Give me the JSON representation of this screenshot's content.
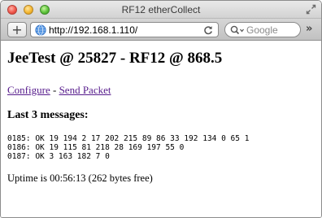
{
  "window": {
    "title": "RF12 etherCollect"
  },
  "toolbar": {
    "new_tab_label": "+",
    "url": "http://192.168.1.110/",
    "search_placeholder": "Google",
    "overflow_label": "»"
  },
  "page": {
    "heading": "JeeTest @ 25827 - RF12 @ 868.5",
    "links": {
      "configure": "Configure",
      "separator": " - ",
      "send_packet": "Send Packet"
    },
    "messages_heading": "Last 3 messages:",
    "messages": [
      "0185: OK 19 194 2 17 202 215 89 86 33 192 134 0 65 1",
      "0186: OK 19 115 81 218 28 169 197 55 0",
      "0187: OK 3 163 182 7 0"
    ],
    "uptime": "Uptime is 00:56:13 (262 bytes free)"
  },
  "icons": {
    "close": "close-window-icon",
    "minimize": "minimize-window-icon",
    "zoom": "zoom-window-icon",
    "resize": "fullscreen-arrows-icon",
    "globe": "globe-icon",
    "reload": "reload-icon",
    "search": "magnifier-icon"
  }
}
